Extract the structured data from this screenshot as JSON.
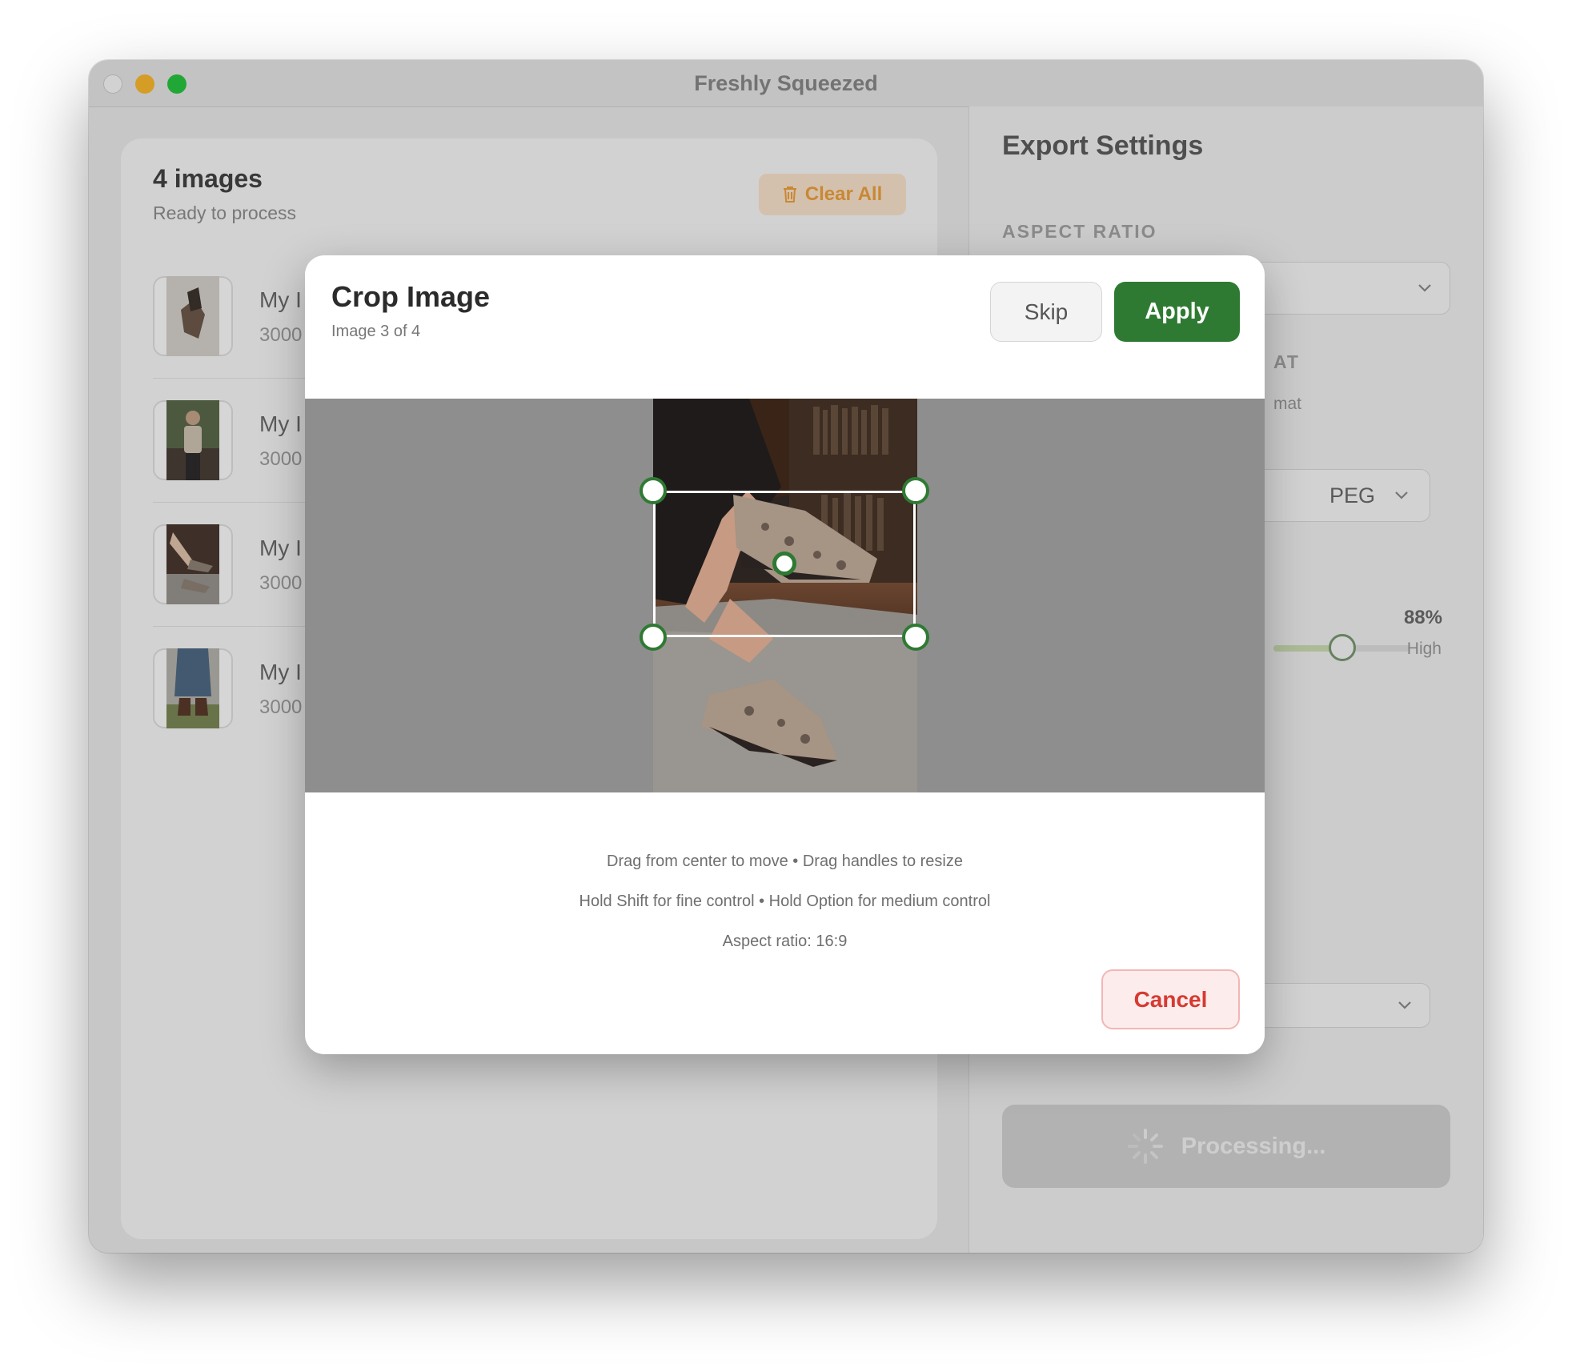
{
  "window": {
    "title": "Freshly Squeezed"
  },
  "file_list": {
    "title": "4 images",
    "subtitle": "Ready to process",
    "clear_all_label": "Clear All",
    "items": [
      {
        "name": "My I",
        "dimensions": "3000"
      },
      {
        "name": "My I",
        "dimensions": "3000"
      },
      {
        "name": "My I",
        "dimensions": "3000"
      },
      {
        "name": "My I",
        "dimensions": "3000"
      }
    ]
  },
  "export_settings": {
    "title": "Export Settings",
    "aspect_ratio_label": "ASPECT RATIO",
    "format_label": "AT",
    "format_sublabel": "mat",
    "format_value": "PEG",
    "quality_percent": "88%",
    "quality_value": 0.88,
    "quality_high_label": "High",
    "process_label": "Processing..."
  },
  "crop_dialog": {
    "title": "Crop Image",
    "subtitle": "Image 3 of 4",
    "skip_label": "Skip",
    "apply_label": "Apply",
    "hint_move": "Drag from center to move • Drag handles to resize",
    "hint_modifiers": "Hold Shift for fine control • Hold Option for medium control",
    "aspect_ratio_text": "Aspect ratio: 16:9",
    "cancel_label": "Cancel"
  },
  "colors": {
    "accent_green": "#2f7a33",
    "cancel_red": "#d63a31",
    "clear_orange": "#f0a23e"
  },
  "icons": [
    "trash-icon",
    "chevron-down-icon",
    "spinner-icon"
  ]
}
